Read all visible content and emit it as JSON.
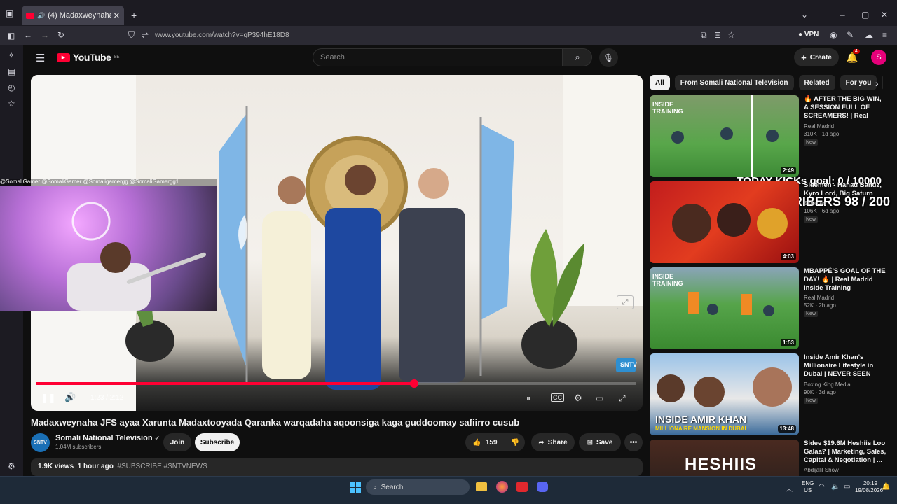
{
  "browser": {
    "tab_title": "(4) Madaxweynaha JFS ayaa",
    "url": "www.youtube.com/watch?v=qP394hE18D8",
    "vpn_label": "VPN",
    "ext_badge": "4"
  },
  "youtube": {
    "logo": "YouTube",
    "logo_region": "SE",
    "search_placeholder": "Search",
    "create_label": "Create",
    "notif_count": "4",
    "avatar_letter": "S"
  },
  "video": {
    "time_display": "1:23 / 2:12",
    "progress_fraction": 0.63,
    "title": "Madaxweynaha JFS ayaa Xarunta Madaxtooyada Qaranka warqadaha aqoonsiga kaga guddoomay safiirro cusub",
    "channel_name": "Somali National Television",
    "channel_avatar_text": "SNTV",
    "subscribers": "1.04M subscribers",
    "join_label": "Join",
    "subscribe_label": "Subscribe",
    "like_count": "159",
    "share_label": "Share",
    "save_label": "Save",
    "views": "1.9K views",
    "time_ago": "1 hour ago",
    "hashtags": "#SUBSCRIBE #SNTVNEWS",
    "watermark": "SNTV"
  },
  "stream_overlay": {
    "socials": "@SomaliGamer  @SomaliGamer  @Somaligamergg  @SomaliGamergg1",
    "goal_kicks": "TODAY KICKs goal: 0 / 10000",
    "goal_subs": "SUBSCRIBERS 98 / 200"
  },
  "chips": [
    "All",
    "From Somali National Television",
    "Related",
    "For you",
    "R"
  ],
  "recommendations": [
    {
      "title": "🔥 AFTER THE BIG WIN, A SESSION FULL OF SCREAMERS! | Real Madrid",
      "channel": "Real Madrid",
      "stats": "310K · 1d ago",
      "badge": "New",
      "duration": "2:49",
      "thumb_text": "INSIDE TRAINING"
    },
    {
      "title": "Sidemen - Hanad Bandz, Kyro Lord, Big Saturn",
      "channel": "Sidemen",
      "stats": "106K · 6d ago",
      "badge": "New",
      "duration": "4:03",
      "thumb_text": ""
    },
    {
      "title": "MBAPPÉ'S GOAL OF THE DAY! 🔥 | Real Madrid Inside Training",
      "channel": "Real Madrid",
      "stats": "52K · 2h ago",
      "badge": "New",
      "duration": "1:53",
      "thumb_text": "INSIDE TRAINING"
    },
    {
      "title": "Inside Amir Khan's Millionaire Lifestyle in Dubai | NEVER SEEN BEFORE! | Boxing Kin...",
      "channel": "Boxing King Media",
      "stats": "90K · 3d ago",
      "badge": "New",
      "duration": "13:48",
      "thumb_text": "INSIDE AMIR KHAN",
      "thumb_sub": "MILLIONAIRE MANSION IN DUBAI"
    },
    {
      "title": "Sidee $19.6M Heshiis Loo Galaa? | Marketing, Sales, Capital & Negotiation | ...",
      "channel": "Abdijalil Show",
      "stats": "",
      "badge": "",
      "duration": "",
      "thumb_text": "HESHIIS"
    }
  ],
  "taskbar": {
    "search_label": "Search",
    "lang": "ENG",
    "region": "US",
    "time": "20:19",
    "date": "19/08/2026"
  },
  "colors": {
    "accent": "#ff0033",
    "bg": "#0f0f0f",
    "flag": "#7fb6e6"
  }
}
